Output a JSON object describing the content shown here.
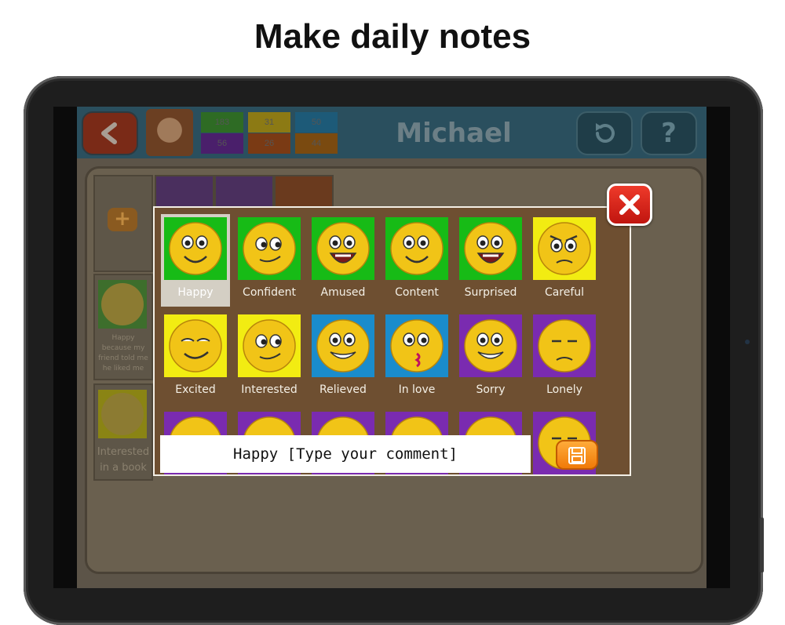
{
  "headline": "Make daily notes",
  "app": {
    "title": "Michael",
    "stats": [
      "183",
      "31",
      "50",
      "56",
      "26",
      "44"
    ],
    "stat_colors": [
      "#2e6b24",
      "#8c7a14",
      "#1d5a78",
      "#4a1f6b",
      "#7a3a14",
      "#7a4a10"
    ]
  },
  "side_cards": [
    {
      "text": "Happy because my friend told me he liked me"
    },
    {
      "text": "Interested in a book"
    }
  ],
  "popup": {
    "emotions": [
      {
        "label": "Happy",
        "color": "#17bb16",
        "selected": true,
        "mood": "smile"
      },
      {
        "label": "Confident",
        "color": "#17bb16",
        "selected": false,
        "mood": "side"
      },
      {
        "label": "Amused",
        "color": "#17bb16",
        "selected": false,
        "mood": "laugh"
      },
      {
        "label": "Content",
        "color": "#17bb16",
        "selected": false,
        "mood": "smile"
      },
      {
        "label": "Surprised",
        "color": "#17bb16",
        "selected": false,
        "mood": "laugh"
      },
      {
        "label": "Careful",
        "color": "#f2ec12",
        "selected": false,
        "mood": "frown"
      },
      {
        "label": "Excited",
        "color": "#f2ec12",
        "selected": false,
        "mood": "smirk"
      },
      {
        "label": "Interested",
        "color": "#f2ec12",
        "selected": false,
        "mood": "side"
      },
      {
        "label": "Relieved",
        "color": "#1a8ccc",
        "selected": false,
        "mood": "grin"
      },
      {
        "label": "In love",
        "color": "#1a8ccc",
        "selected": false,
        "mood": "kiss"
      },
      {
        "label": "Sorry",
        "color": "#7a2bb0",
        "selected": false,
        "mood": "grin"
      },
      {
        "label": "Lonely",
        "color": "#7a2bb0",
        "selected": false,
        "mood": "sad"
      },
      {
        "label": "",
        "color": "#7a2bb0",
        "selected": false,
        "mood": "sad"
      },
      {
        "label": "",
        "color": "#7a2bb0",
        "selected": false,
        "mood": "sad"
      },
      {
        "label": "",
        "color": "#7a2bb0",
        "selected": false,
        "mood": "sad"
      },
      {
        "label": "",
        "color": "#7a2bb0",
        "selected": false,
        "mood": "sad"
      },
      {
        "label": "",
        "color": "#7a2bb0",
        "selected": false,
        "mood": "sad"
      },
      {
        "label": "",
        "color": "#7a2bb0",
        "selected": false,
        "mood": "sad"
      }
    ],
    "comment_text": "Happy [Type your comment]",
    "save_icon": "floppy-disk-icon",
    "close_icon": "close-icon"
  }
}
